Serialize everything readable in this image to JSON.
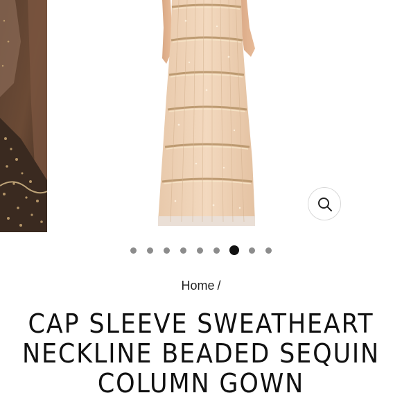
{
  "gallery": {
    "zoom_icon": "magnifier-icon",
    "slide_count": 9,
    "active_slide": 7
  },
  "breadcrumb": {
    "home_label": "Home",
    "separator": "/"
  },
  "product": {
    "title": "CAP SLEEVE SWEATHEART NECKLINE BEADED SEQUIN COLUMN GOWN"
  }
}
